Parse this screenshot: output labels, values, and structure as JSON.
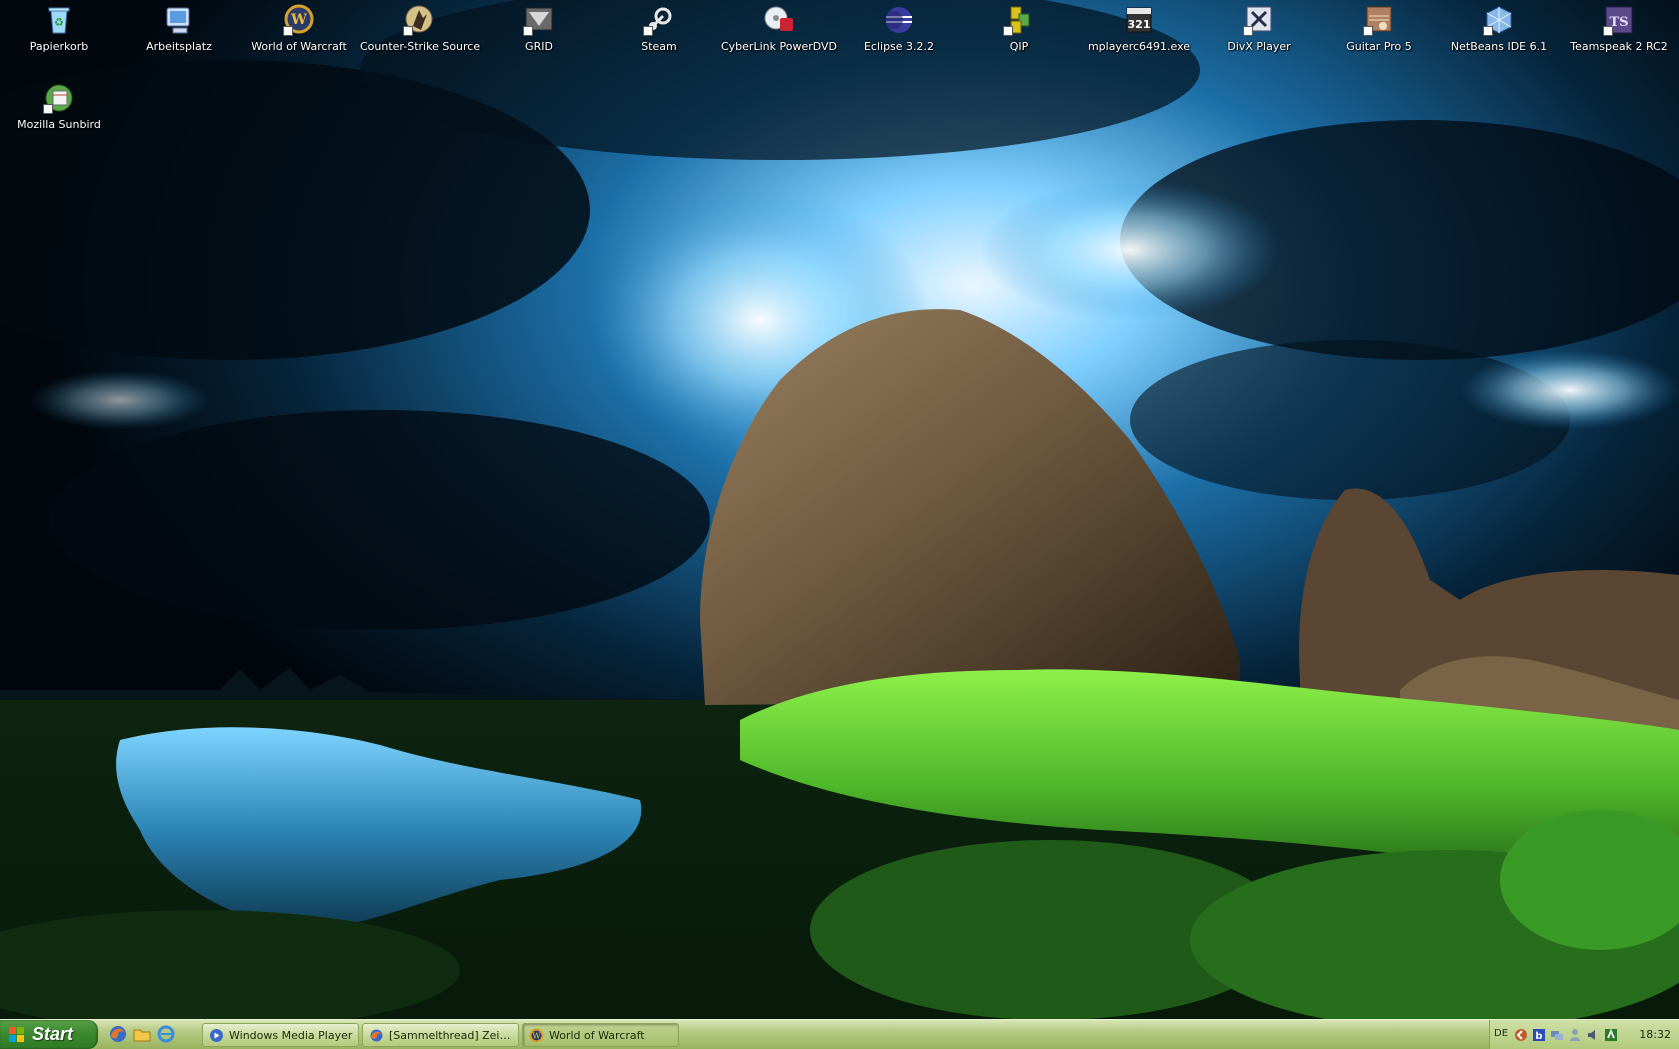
{
  "desktop": {
    "icons": [
      {
        "label": "Papierkorb",
        "icon": "recycle-bin-icon",
        "color": "#7fc8f0"
      },
      {
        "label": "Arbeitsplatz",
        "icon": "my-computer-icon",
        "color": "#a9c8f5"
      },
      {
        "label": "World of Warcraft",
        "icon": "wow-icon",
        "color": "#d8a02a"
      },
      {
        "label": "Counter-Strike Source",
        "icon": "cs-source-icon",
        "color": "#c9a46a"
      },
      {
        "label": "GRID",
        "icon": "grid-icon",
        "color": "#9a9a9a"
      },
      {
        "label": "Steam",
        "icon": "steam-icon",
        "color": "#1a1a1a"
      },
      {
        "label": "CyberLink PowerDVD",
        "icon": "powerdvd-icon",
        "color": "#cc2233"
      },
      {
        "label": "Eclipse 3.2.2",
        "icon": "eclipse-icon",
        "color": "#3a3d9e"
      },
      {
        "label": "QIP",
        "icon": "qip-icon",
        "color": "#d8c21c"
      },
      {
        "label": "mplayerc6491.exe",
        "icon": "mplayer-icon",
        "color": "#333333"
      },
      {
        "label": "DivX Player",
        "icon": "divx-icon",
        "color": "#dfe4ec"
      },
      {
        "label": "Guitar Pro 5",
        "icon": "guitar-pro-icon",
        "color": "#9a6a4a"
      },
      {
        "label": "NetBeans IDE 6.1",
        "icon": "netbeans-icon",
        "color": "#8ab8e8"
      },
      {
        "label": "Teamspeak 2 RC2",
        "icon": "teamspeak-icon",
        "color": "#5a4a8a"
      },
      {
        "label": "Mozilla Sunbird",
        "icon": "sunbird-icon",
        "color": "#5aa84a"
      }
    ]
  },
  "taskbar": {
    "start_label": "Start",
    "quicklaunch": [
      {
        "icon": "firefox-icon",
        "color": "#e0782a"
      },
      {
        "icon": "explorer-folder-icon",
        "color": "#f0c84a"
      },
      {
        "icon": "internet-explorer-icon",
        "color": "#3a8ae0"
      }
    ],
    "quicklaunch_more": "»",
    "tasks": [
      {
        "label": "Windows Media Player",
        "icon": "media-player-icon",
        "color": "#3a6ac8"
      },
      {
        "label": "[Sammelthread] Zeigt...",
        "icon": "firefox-icon",
        "color": "#e0782a"
      },
      {
        "label": "World of Warcraft",
        "icon": "wow-icon",
        "color": "#d8a02a"
      }
    ],
    "tray": {
      "language": "DE",
      "icons": [
        {
          "icon": "tray-arrow-icon",
          "color": "#c05a2a"
        },
        {
          "icon": "tray-b-icon",
          "color": "#2a4ab8"
        },
        {
          "icon": "tray-network-icon",
          "color": "#6a8ab8"
        },
        {
          "icon": "tray-user-icon",
          "color": "#8aa0b8"
        },
        {
          "icon": "tray-speaker-icon",
          "color": "#4a5a6a"
        },
        {
          "icon": "tray-app-icon",
          "color": "#2a7a2a"
        }
      ],
      "clock": "18:32"
    }
  }
}
